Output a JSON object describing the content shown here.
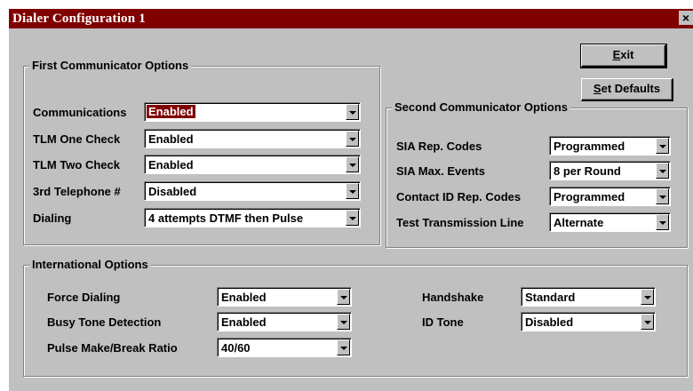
{
  "window": {
    "title": "Dialer Configuration 1",
    "close_glyph": "×"
  },
  "buttons": {
    "exit": {
      "pre": "",
      "key": "E",
      "post": "xit"
    },
    "set_defaults": {
      "pre": "",
      "key": "S",
      "post": "et Defaults"
    }
  },
  "first": {
    "title": "First Communicator Options",
    "rows": [
      {
        "label": "Communications",
        "value": "Enabled"
      },
      {
        "label": "TLM One Check",
        "value": "Enabled"
      },
      {
        "label": "TLM Two Check",
        "value": "Enabled"
      },
      {
        "label": "3rd Telephone #",
        "value": "Disabled"
      },
      {
        "label": "Dialing",
        "value": "4 attempts DTMF then Pulse"
      }
    ]
  },
  "second": {
    "title": "Second Communicator Options",
    "rows": [
      {
        "label": "SIA Rep. Codes",
        "value": "Programmed"
      },
      {
        "label": "SIA Max. Events",
        "value": "8 per Round"
      },
      {
        "label": "Contact ID Rep. Codes",
        "value": "Programmed"
      },
      {
        "label": "Test Transmission Line",
        "value": "Alternate"
      }
    ]
  },
  "intl": {
    "title": "International Options",
    "force_dialing": {
      "label": "Force Dialing",
      "value": "Enabled"
    },
    "busy_tone": {
      "label": "Busy Tone Detection",
      "value": "Enabled"
    },
    "pulse_ratio": {
      "label": "Pulse Make/Break Ratio",
      "value": "40/60"
    },
    "handshake": {
      "label": "Handshake",
      "value": "Standard"
    },
    "id_tone": {
      "label": "ID Tone",
      "value": "Disabled"
    }
  }
}
